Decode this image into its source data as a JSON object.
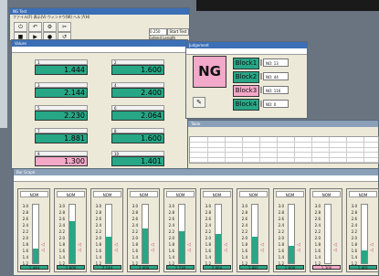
{
  "toolbar_window": {
    "title": "NG Test",
    "menu": "ファイル(F)  表示(V)  ウィンドウ(W)  ヘルプ(H)",
    "value_box": "0.250",
    "checkbox_label": "Extend Length",
    "start_button": "Start Test"
  },
  "values_window": {
    "title": "Values",
    "tiles": [
      {
        "id": "1",
        "value": "1.444",
        "state": "ok"
      },
      {
        "id": "2",
        "value": "1.600",
        "state": "ok"
      },
      {
        "id": "3",
        "value": "2.144",
        "state": "ok"
      },
      {
        "id": "4",
        "value": "2.400",
        "state": "ok"
      },
      {
        "id": "5",
        "value": "2.230",
        "state": "ok"
      },
      {
        "id": "6",
        "value": "2.064",
        "state": "ok"
      },
      {
        "id": "7",
        "value": "1.881",
        "state": "ok"
      },
      {
        "id": "8",
        "value": "1.600",
        "state": "ok"
      },
      {
        "id": "9",
        "value": "1.300",
        "state": "ng"
      },
      {
        "id": "10",
        "value": "1.401",
        "state": "ok"
      }
    ]
  },
  "ng_window": {
    "title": "Judgement",
    "result": "NG",
    "blocks": [
      {
        "label": "Block1",
        "state": "ok",
        "field": "NO: 13"
      },
      {
        "label": "Block2",
        "state": "ok",
        "field": "NO: 44"
      },
      {
        "label": "Block3",
        "state": "ng",
        "field": "NO: 116"
      },
      {
        "label": "Block4",
        "state": "ok",
        "field": "NO: 0"
      }
    ]
  },
  "table_window": {
    "title": "Table"
  },
  "gauges_window": {
    "title": "Bar Graph",
    "scale": [
      "3.0",
      "2.8",
      "2.6",
      "2.4",
      "2.2",
      "2.0",
      "1.8",
      "1.6",
      "1.4",
      "1.2"
    ],
    "gauges": [
      {
        "label": "NOM",
        "value": "1.444",
        "level": 0.25,
        "state": "ok"
      },
      {
        "label": "NOM",
        "value": "1.600",
        "level": 0.72,
        "state": "ok"
      },
      {
        "label": "NOM",
        "value": "2.144",
        "level": 0.45,
        "state": "ok"
      },
      {
        "label": "NOM",
        "value": "2.400",
        "level": 0.6,
        "state": "ok"
      },
      {
        "label": "NOM",
        "value": "2.230",
        "level": 0.55,
        "state": "ok"
      },
      {
        "label": "NOM",
        "value": "2.064",
        "level": 0.5,
        "state": "ok"
      },
      {
        "label": "NOM",
        "value": "1.881",
        "level": 0.45,
        "state": "ok"
      },
      {
        "label": "NOM",
        "value": "1.600",
        "level": 0.3,
        "state": "ok"
      },
      {
        "label": "NOM",
        "value": "1.300",
        "level": 0.0,
        "state": "ng"
      },
      {
        "label": "NOM",
        "value": "1.401",
        "level": 0.22,
        "state": "ok"
      }
    ]
  },
  "colors": {
    "ok": "#27a786",
    "ng": "#f4a8c8"
  }
}
